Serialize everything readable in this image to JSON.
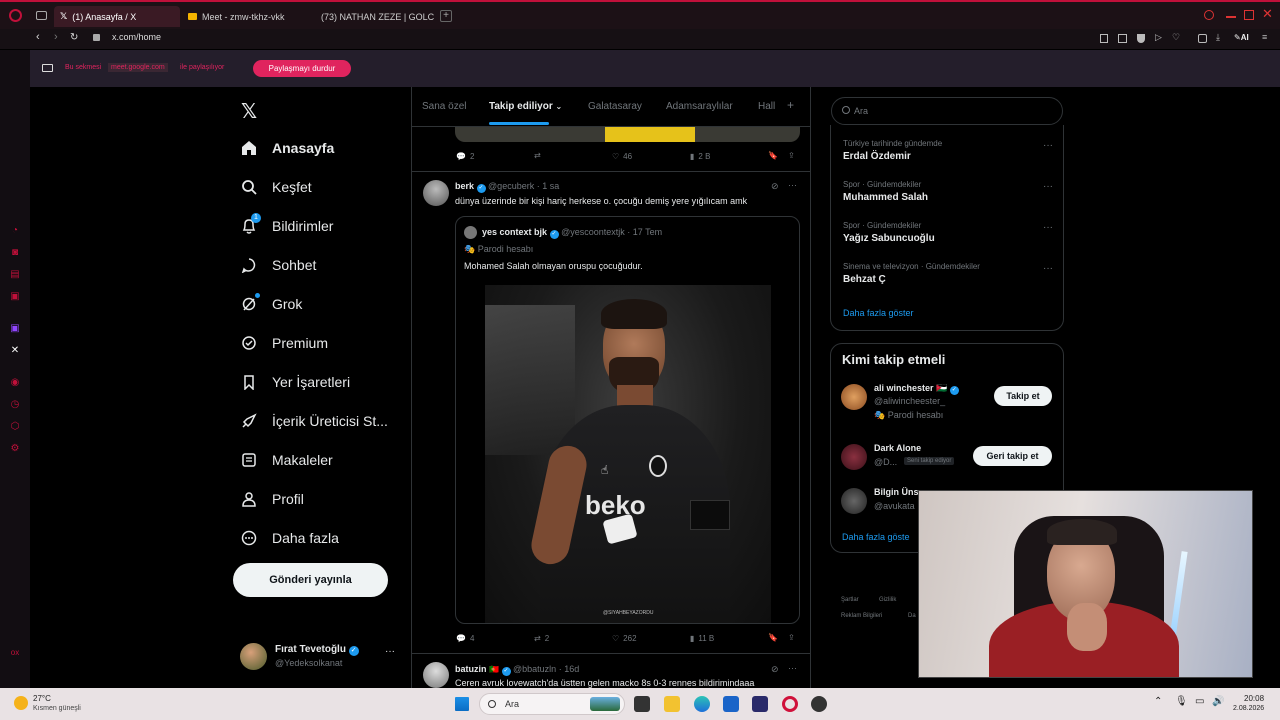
{
  "browser": {
    "tabs": [
      {
        "label": "(1) Anasayfa / X",
        "active": true
      },
      {
        "label": "Meet - zmw-tkhz-vkk",
        "active": false
      },
      {
        "label": "(73) NATHAN ZEZE | GOLC",
        "active": false
      }
    ],
    "url": "x.com/home",
    "ai_label": "AI"
  },
  "share_bar": {
    "prefix": "Bu sekmesi",
    "domain": "meet.google.com",
    "suffix": "ile paylaşılıyor",
    "stop_button": "Paylaşmayı durdur"
  },
  "left_nav": {
    "items": [
      {
        "label": "Anasayfa",
        "icon": "home-icon"
      },
      {
        "label": "Keşfet",
        "icon": "search-icon"
      },
      {
        "label": "Bildirimler",
        "icon": "bell-icon",
        "badge": "1"
      },
      {
        "label": "Sohbet",
        "icon": "chat-icon"
      },
      {
        "label": "Grok",
        "icon": "grok-icon"
      },
      {
        "label": "Premium",
        "icon": "premium-icon"
      },
      {
        "label": "Yer İşaretleri",
        "icon": "bookmark-icon"
      },
      {
        "label": "İçerik Üreticisi St...",
        "icon": "rocket-icon"
      },
      {
        "label": "Makaleler",
        "icon": "article-icon"
      },
      {
        "label": "Profil",
        "icon": "person-icon"
      },
      {
        "label": "Daha fazla",
        "icon": "more-circle-icon"
      }
    ],
    "post_button": "Gönderi yayınla",
    "account": {
      "name": "Fırat Tevetoğlu",
      "handle": "@Yedeksolkanat"
    }
  },
  "timeline": {
    "tabs": [
      "Sana özel",
      "Takip ediliyor",
      "Galatasaray",
      "Adamsaraylılar",
      "Hall"
    ],
    "active_tab": "Takip ediliyor",
    "prev_post_actions": {
      "replies": "2",
      "likes": "46",
      "views": "2 B"
    },
    "post1": {
      "name": "berk",
      "handle": "@gecuberk",
      "time": "· 1 sa",
      "text": "dünya üzerinde bir kişi hariç herkese o. çocuğu demiş yere yığılıcam amk",
      "quote": {
        "name": "yes context bjk",
        "handle": "@yescoontextjk",
        "time": "· 17 Tem",
        "parody": "Parodi hesabı",
        "text": "Mohamed Salah olmayan oruspu çocuğudur.",
        "image_watermark": "@SIYAHBEYAZORDU",
        "shirt_text": "beko"
      },
      "actions": {
        "replies": "4",
        "reposts": "2",
        "likes": "262",
        "views": "11 B"
      }
    },
    "post2": {
      "name": "batuzin",
      "handle": "@bbatuzln",
      "time": "· 16d",
      "text": "Ceren avruk lovewatch'da üstten gelen macko 8s 0-3 rennes bildirimindaaa"
    }
  },
  "right": {
    "search_placeholder": "Ara",
    "trends": [
      {
        "meta": "Türkiye tarihinde gündemde",
        "name": "Erdal Özdemir"
      },
      {
        "meta": "Spor · Gündemdekiler",
        "name": "Muhammed Salah"
      },
      {
        "meta": "Spor · Gündemdekiler",
        "name": "Yağız Sabuncuoğlu"
      },
      {
        "meta": "Sinema ve televizyon · Gündemdekiler",
        "name": "Behzat Ç"
      }
    ],
    "show_more": "Daha fazla göster",
    "who_title": "Kimi takip etmeli",
    "who": [
      {
        "name": "ali winchester",
        "handle": "@aliwincheester_",
        "sub": "Parodi hesabı",
        "button": "Takip et"
      },
      {
        "name": "Dark Alone",
        "handle": "@D...",
        "badge": "Seni takip ediyor",
        "button": "Geri takip et"
      },
      {
        "name": "Bilgin Üns",
        "handle": "@avukata"
      }
    ],
    "who_more": "Daha fazla göste",
    "footer": [
      "Şartlar",
      "Gizlilik",
      "Reklam Bilgileri",
      "Da"
    ]
  },
  "taskbar": {
    "weather_temp": "27°C",
    "weather_desc": "Kısmen güneşli",
    "search": "Ara",
    "time": "20:08",
    "date": "2.08.2026"
  },
  "colors": {
    "accent": "#1d9bf0",
    "opera_red": "#c0103a",
    "share_button": "#e0245e"
  }
}
